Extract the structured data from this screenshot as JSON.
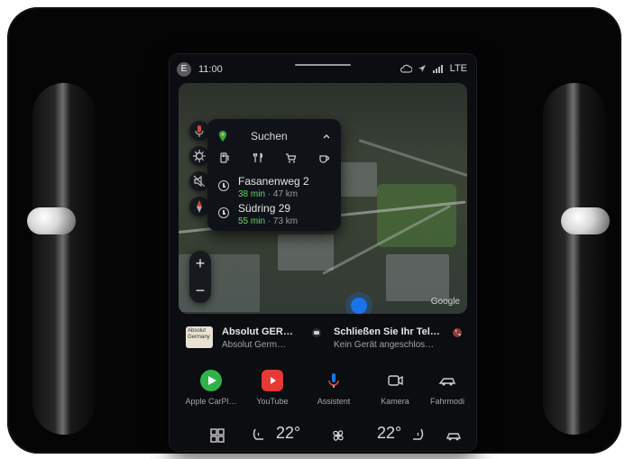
{
  "status": {
    "avatar_letter": "E",
    "time": "11:00",
    "network": "LTE"
  },
  "map": {
    "search_label": "Suchen",
    "destinations": [
      {
        "name": "Fasanenweg 2",
        "duration": "38 min",
        "distance": "47 km"
      },
      {
        "name": "Südring 29",
        "duration": "55 min",
        "distance": "73 km"
      }
    ],
    "attribution": "Google",
    "zoom_in": "+",
    "zoom_out": "−"
  },
  "media": {
    "left": {
      "thumb_text": "Absolut Germany",
      "title": "Absolut GER…",
      "subtitle": "Absolut Germ…"
    },
    "right": {
      "title": "Schließen Sie Ihr Tel…",
      "subtitle": "Kein Gerät angeschlos…"
    }
  },
  "apps": [
    {
      "label": "Apple CarPl…",
      "icon": "carplay-icon"
    },
    {
      "label": "YouTube",
      "icon": "youtube-icon"
    },
    {
      "label": "Assistent",
      "icon": "microphone-icon"
    },
    {
      "label": "Kamera",
      "icon": "camera-icon"
    },
    {
      "label": "Fahrmodi",
      "icon": "car-mode-icon"
    }
  ],
  "climate": {
    "left_temp": "22°",
    "right_temp": "22°"
  },
  "colors": {
    "accent_blue": "#1a73e8",
    "green": "#6ad36a",
    "youtube_red": "#e53935",
    "carplay_green": "#2fb24a"
  }
}
